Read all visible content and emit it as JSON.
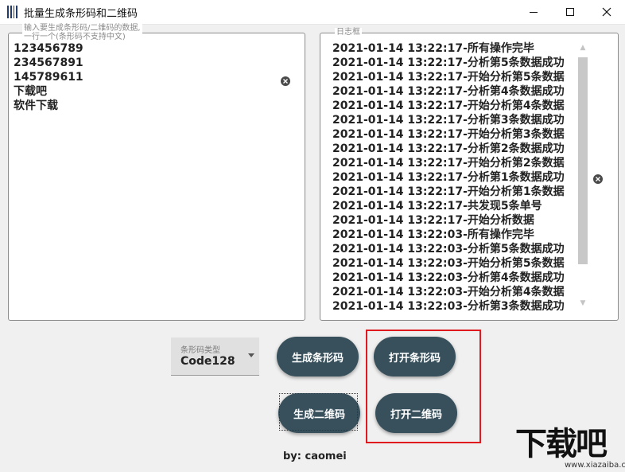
{
  "window": {
    "title": "批量生成条形码和二维码",
    "controls": [
      "minimize-icon",
      "maximize-icon",
      "close-icon"
    ]
  },
  "input_panel": {
    "legend_line1": "输入要生成条形码/二维码的数据,",
    "legend_line2": "一行一个(条形码不支持中文)",
    "lines": [
      "123456789",
      "234567891",
      "145789611",
      "下载吧",
      "软件下载"
    ],
    "clear_icon": "clear-icon"
  },
  "log_panel": {
    "legend": "日志框",
    "lines": [
      "2021-01-14 13:22:17-所有操作完毕",
      "2021-01-14 13:22:17-分析第5条数据成功",
      "2021-01-14 13:22:17-开始分析第5条数据",
      "2021-01-14 13:22:17-分析第4条数据成功",
      "2021-01-14 13:22:17-开始分析第4条数据",
      "2021-01-14 13:22:17-分析第3条数据成功",
      "2021-01-14 13:22:17-开始分析第3条数据",
      "2021-01-14 13:22:17-分析第2条数据成功",
      "2021-01-14 13:22:17-开始分析第2条数据",
      "2021-01-14 13:22:17-分析第1条数据成功",
      "2021-01-14 13:22:17-开始分析第1条数据",
      "2021-01-14 13:22:17-共发现5条单号",
      "2021-01-14 13:22:17-开始分析数据",
      "2021-01-14 13:22:03-所有操作完毕",
      "2021-01-14 13:22:03-分析第5条数据成功",
      "2021-01-14 13:22:03-开始分析第5条数据",
      "2021-01-14 13:22:03-分析第4条数据成功",
      "2021-01-14 13:22:03-开始分析第4条数据",
      "2021-01-14 13:22:03-分析第3条数据成功"
    ]
  },
  "barcode_type": {
    "label": "条形码类型",
    "value": "Code128"
  },
  "buttons": {
    "gen_barcode": "生成条形码",
    "open_barcode": "打开条形码",
    "gen_qrcode": "生成二维码",
    "open_qrcode": "打开二维码"
  },
  "author": "by: caomei",
  "watermark": {
    "text": "下载吧",
    "url": "www.xiazaiba.com"
  },
  "colors": {
    "button": "#37505c",
    "highlight": "#e0191e"
  }
}
